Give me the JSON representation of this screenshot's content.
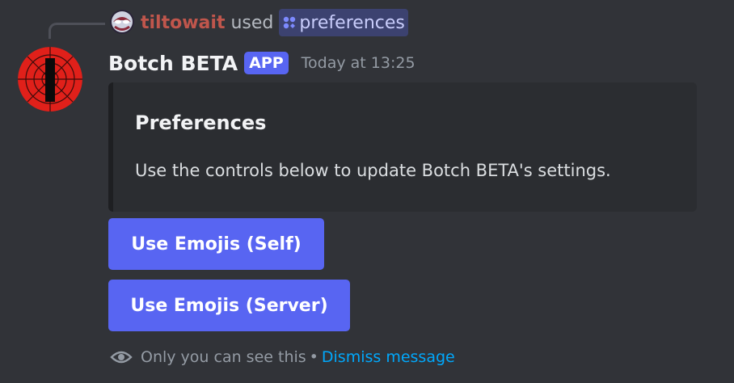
{
  "interaction": {
    "user": "tiltowait",
    "action": "used",
    "command": "preferences",
    "user_color": "#c0564c",
    "avatar_icon": "spider-avatar-icon",
    "command_icon": "slash-command-icon"
  },
  "message": {
    "author": "Botch BETA",
    "badge": "APP",
    "timestamp": "Today at 13:25",
    "avatar_icon": "bot-avatar-icon"
  },
  "embed": {
    "title": "Preferences",
    "description": "Use the controls below to update Botch BETA's settings."
  },
  "buttons": [
    {
      "label": "Use Emojis (Self)"
    },
    {
      "label": "Use Emojis (Server)"
    }
  ],
  "footer": {
    "notice": "Only you can see this",
    "separator": "•",
    "dismiss": "Dismiss message",
    "icon": "eye-icon"
  },
  "colors": {
    "background": "#313338",
    "embed_background": "#2b2d31",
    "blurple": "#5865f2",
    "link": "#00a8fc"
  }
}
